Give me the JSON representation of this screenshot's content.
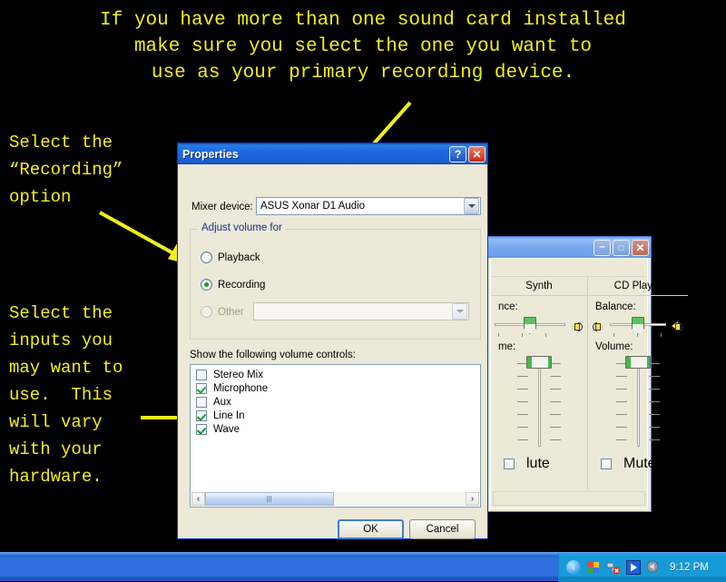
{
  "annotations": {
    "top_note": "If you have more than one sound card installed\nmake sure you select the one you want to\nuse as your primary recording device.",
    "left_note_1": "Select the\n“Recording”\noption",
    "left_note_2": "Select the\ninputs you\nmay want to\nuse.  This\nwill vary\nwith your\nhardware.",
    "color": "#f2ef19"
  },
  "properties_dialog": {
    "title": "Properties",
    "help_button": "?",
    "close_button": "✕",
    "mixer_device_label": "Mixer device:",
    "mixer_device_value": "ASUS Xonar D1 Audio",
    "group_title": "Adjust volume for",
    "radios": [
      {
        "label": "Playback",
        "checked": false,
        "disabled": false
      },
      {
        "label": "Recording",
        "checked": true,
        "disabled": false
      },
      {
        "label": "Other",
        "checked": false,
        "disabled": true
      }
    ],
    "other_combo_value": "",
    "list_label": "Show the following volume controls:",
    "controls": [
      {
        "label": "Stereo Mix",
        "checked": false
      },
      {
        "label": "Microphone",
        "checked": true
      },
      {
        "label": "Aux",
        "checked": false
      },
      {
        "label": "Line In",
        "checked": true
      },
      {
        "label": "Wave",
        "checked": true
      }
    ],
    "scroll_left": "‹",
    "scroll_right": "›",
    "ok_label": "OK",
    "cancel_label": "Cancel"
  },
  "volume_window": {
    "minimize_button": "–",
    "maximize_button": "❐",
    "close_button": "✕",
    "columns": [
      {
        "name": "Synth",
        "balance_label": "nce:",
        "volume_label": "me:",
        "mute_label": "lute",
        "mute_checked": false
      },
      {
        "name": "CD Player",
        "balance_label": "Balance:",
        "volume_label": "Volume:",
        "mute_label": "Mute",
        "mute_checked": false
      }
    ]
  },
  "taskbar": {
    "clock": "9:12 PM",
    "tray_expand": "‹",
    "icons": [
      "security-center-icon",
      "network-warning-icon",
      "media-player-icon",
      "volume-icon"
    ]
  }
}
